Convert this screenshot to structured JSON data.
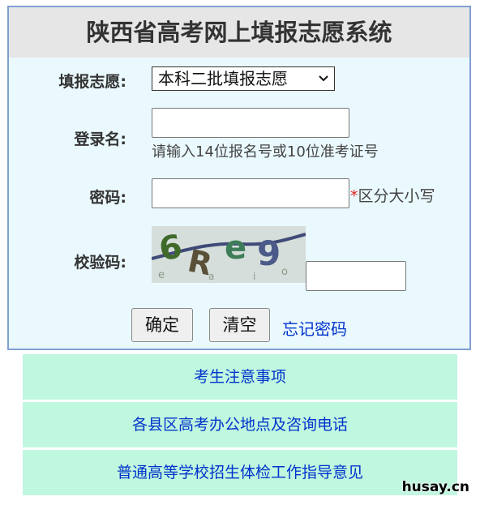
{
  "header": {
    "title": "陕西省高考网上填报志愿系统"
  },
  "form": {
    "volunteer_label": "填报志愿:",
    "volunteer_selected": "本科二批填报志愿",
    "username_label": "登录名:",
    "username_value": "",
    "username_hint": "请输入14位报名号或10位准考证号",
    "password_label": "密码:",
    "password_value": "",
    "password_required_mark": "*",
    "password_hint": "区分大小写",
    "captcha_label": "校验码:",
    "captcha_value": "",
    "captcha_chars": [
      "6",
      "R",
      "e",
      "9"
    ],
    "captcha_noise": [
      "e",
      "a",
      "i",
      "o"
    ],
    "confirm_label": "确定",
    "clear_label": "清空",
    "forgot_label": "忘记密码"
  },
  "nav": {
    "items": [
      {
        "label": "考生注意事项"
      },
      {
        "label": "各县区高考办公地点及咨询电话"
      },
      {
        "label": "普通高等学校招生体检工作指导意见"
      }
    ]
  },
  "watermark": "husay.cn",
  "colors": {
    "panel_bg": "#eaf9fe",
    "panel_border": "#7f9fd0",
    "title_bg": "#e6e6e6",
    "nav_bg": "#c0f7df",
    "link": "#0033cc",
    "required": "#e02020"
  }
}
